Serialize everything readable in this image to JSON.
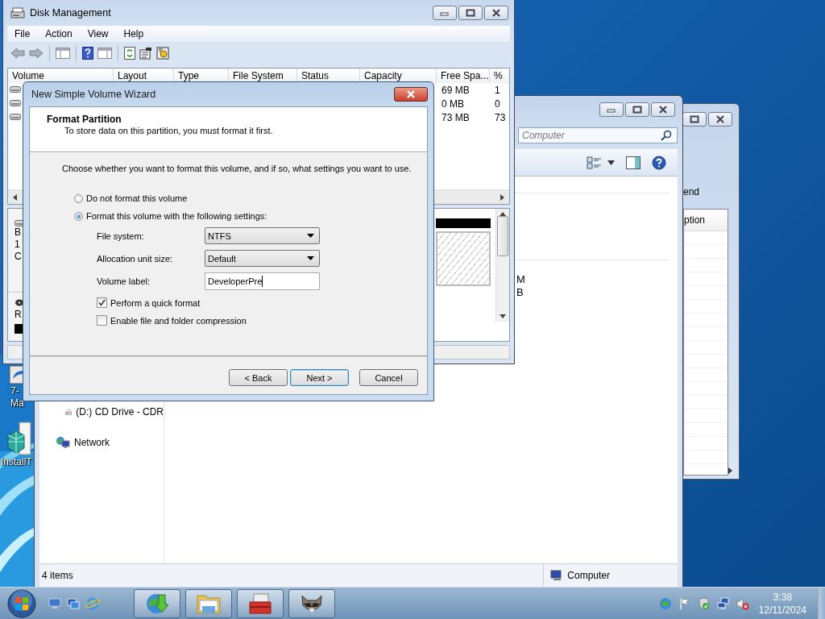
{
  "desktop": {
    "icons": [
      {
        "kind": "shortcut",
        "label_lines": [
          "7-",
          "Ma"
        ]
      },
      {
        "kind": "cubes",
        "label_lines": [
          "InstallT"
        ]
      }
    ]
  },
  "back_window": {
    "text": "end",
    "list_header": "ption"
  },
  "explorer": {
    "search": {
      "placeholder": "Computer"
    },
    "fragments": [
      "M",
      "B"
    ],
    "nav": [
      {
        "kind": "cd",
        "label": "(D:) CD Drive - CDR"
      },
      {
        "kind": "network",
        "label": "Network"
      }
    ],
    "status_bar": {
      "count": "4 items",
      "location": "Computer"
    }
  },
  "disk_management": {
    "title": "Disk Management",
    "menu": [
      {
        "label": "File"
      },
      {
        "label": "Action"
      },
      {
        "label": "View"
      },
      {
        "label": "Help"
      }
    ],
    "columns": [
      "Volume",
      "Layout",
      "Type",
      "File System",
      "Status",
      "Capacity",
      "Free Spa...",
      "%"
    ],
    "rows": [
      {
        "free_space": "69 MB",
        "percent_free": "1"
      },
      {
        "free_space": "0 MB",
        "percent_free": "0"
      },
      {
        "free_space": "73 MB",
        "percent_free": "73"
      }
    ],
    "disk_labels": [
      "B",
      "1",
      "C"
    ],
    "cd_label": "R"
  },
  "wizard": {
    "title": "New Simple Volume Wizard",
    "heading": "Format Partition",
    "subheading": "To store data on this partition, you must format it first.",
    "prompt": "Choose whether you want to format this volume, and if so, what settings you want to use.",
    "options": [
      {
        "label": "Do not format this volume",
        "selected": false
      },
      {
        "label": "Format this volume with the following settings:",
        "selected": true
      }
    ],
    "settings": [
      {
        "kind": "dropdown",
        "label": "File system:",
        "value": "NTFS"
      },
      {
        "kind": "dropdown",
        "label": "Allocation unit size:",
        "value": "Default"
      },
      {
        "kind": "text",
        "label": "Volume label:",
        "value": "DeveloperPre",
        "focused": true
      }
    ],
    "checkboxes": [
      {
        "label": "Perform a quick format",
        "checked": true
      },
      {
        "label": "Enable file and folder compression",
        "checked": false
      }
    ],
    "buttons": [
      {
        "label": "< Back",
        "default": false
      },
      {
        "label": "Next >",
        "default": true
      },
      {
        "label": "Cancel",
        "default": false
      }
    ]
  },
  "taskbar": {
    "quick_launch": [
      {
        "kind": "desktop"
      },
      {
        "kind": "switch"
      },
      {
        "kind": "browser"
      }
    ],
    "tasks": [
      {
        "kind": "download"
      },
      {
        "kind": "folder"
      },
      {
        "kind": "toolbox"
      },
      {
        "kind": "animal"
      }
    ],
    "tray": [
      {
        "kind": "globe"
      },
      {
        "kind": "flag"
      },
      {
        "kind": "shield"
      },
      {
        "kind": "display"
      },
      {
        "kind": "muted"
      }
    ],
    "time": "3:38",
    "date": "12/11/2024"
  }
}
